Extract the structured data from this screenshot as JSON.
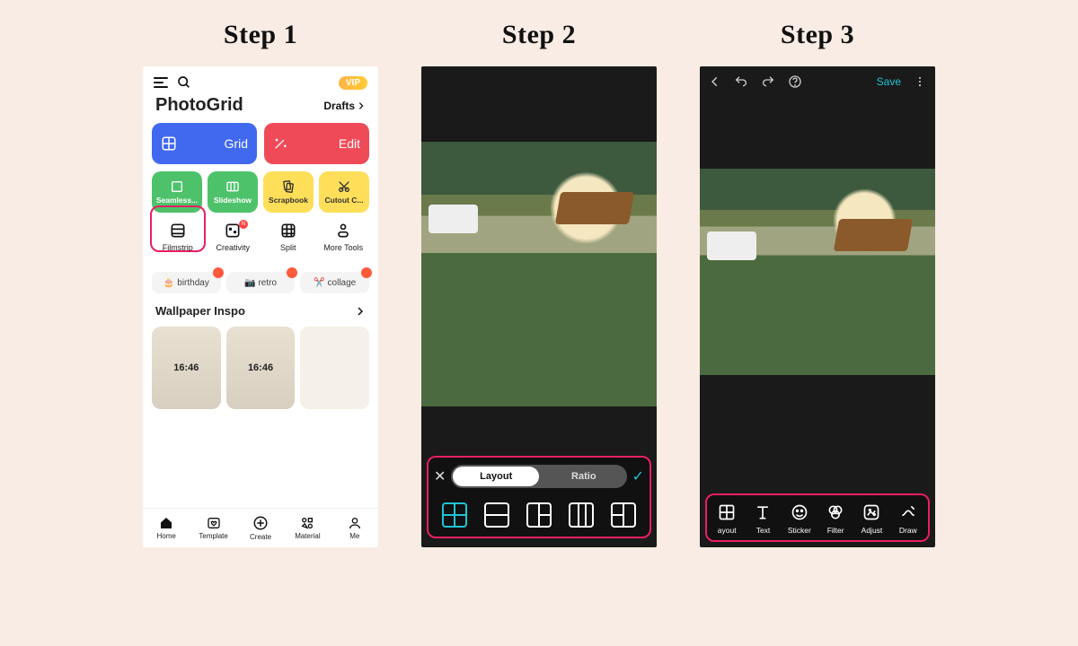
{
  "step_labels": {
    "s1": "Step 1",
    "s2": "Step 2",
    "s3": "Step 3"
  },
  "s1": {
    "vip": "VIP",
    "app_title": "PhotoGrid",
    "drafts": "Drafts",
    "grid_btn": "Grid",
    "edit_btn": "Edit",
    "tiles": [
      {
        "label": "Seamless..."
      },
      {
        "label": "Slideshow"
      },
      {
        "label": "Scrapbook"
      },
      {
        "label": "Cutout C..."
      }
    ],
    "icon_row": [
      {
        "label": "Filmstrip"
      },
      {
        "label": "Creativity"
      },
      {
        "label": "Split"
      },
      {
        "label": "More Tools"
      }
    ],
    "chips": [
      {
        "label": "birthday"
      },
      {
        "label": "retro"
      },
      {
        "label": "collage"
      }
    ],
    "section": "Wallpaper Inspo",
    "clock": "16:46",
    "tabs": [
      {
        "label": "Home"
      },
      {
        "label": "Template"
      },
      {
        "label": "Create"
      },
      {
        "label": "Material"
      },
      {
        "label": "Me"
      }
    ]
  },
  "s2": {
    "seg": {
      "layout": "Layout",
      "ratio": "Ratio"
    }
  },
  "s3": {
    "save": "Save",
    "tools": [
      {
        "label": "ayout"
      },
      {
        "label": "Text"
      },
      {
        "label": "Sticker"
      },
      {
        "label": "Filter"
      },
      {
        "label": "Adjust"
      },
      {
        "label": "Draw"
      }
    ]
  }
}
